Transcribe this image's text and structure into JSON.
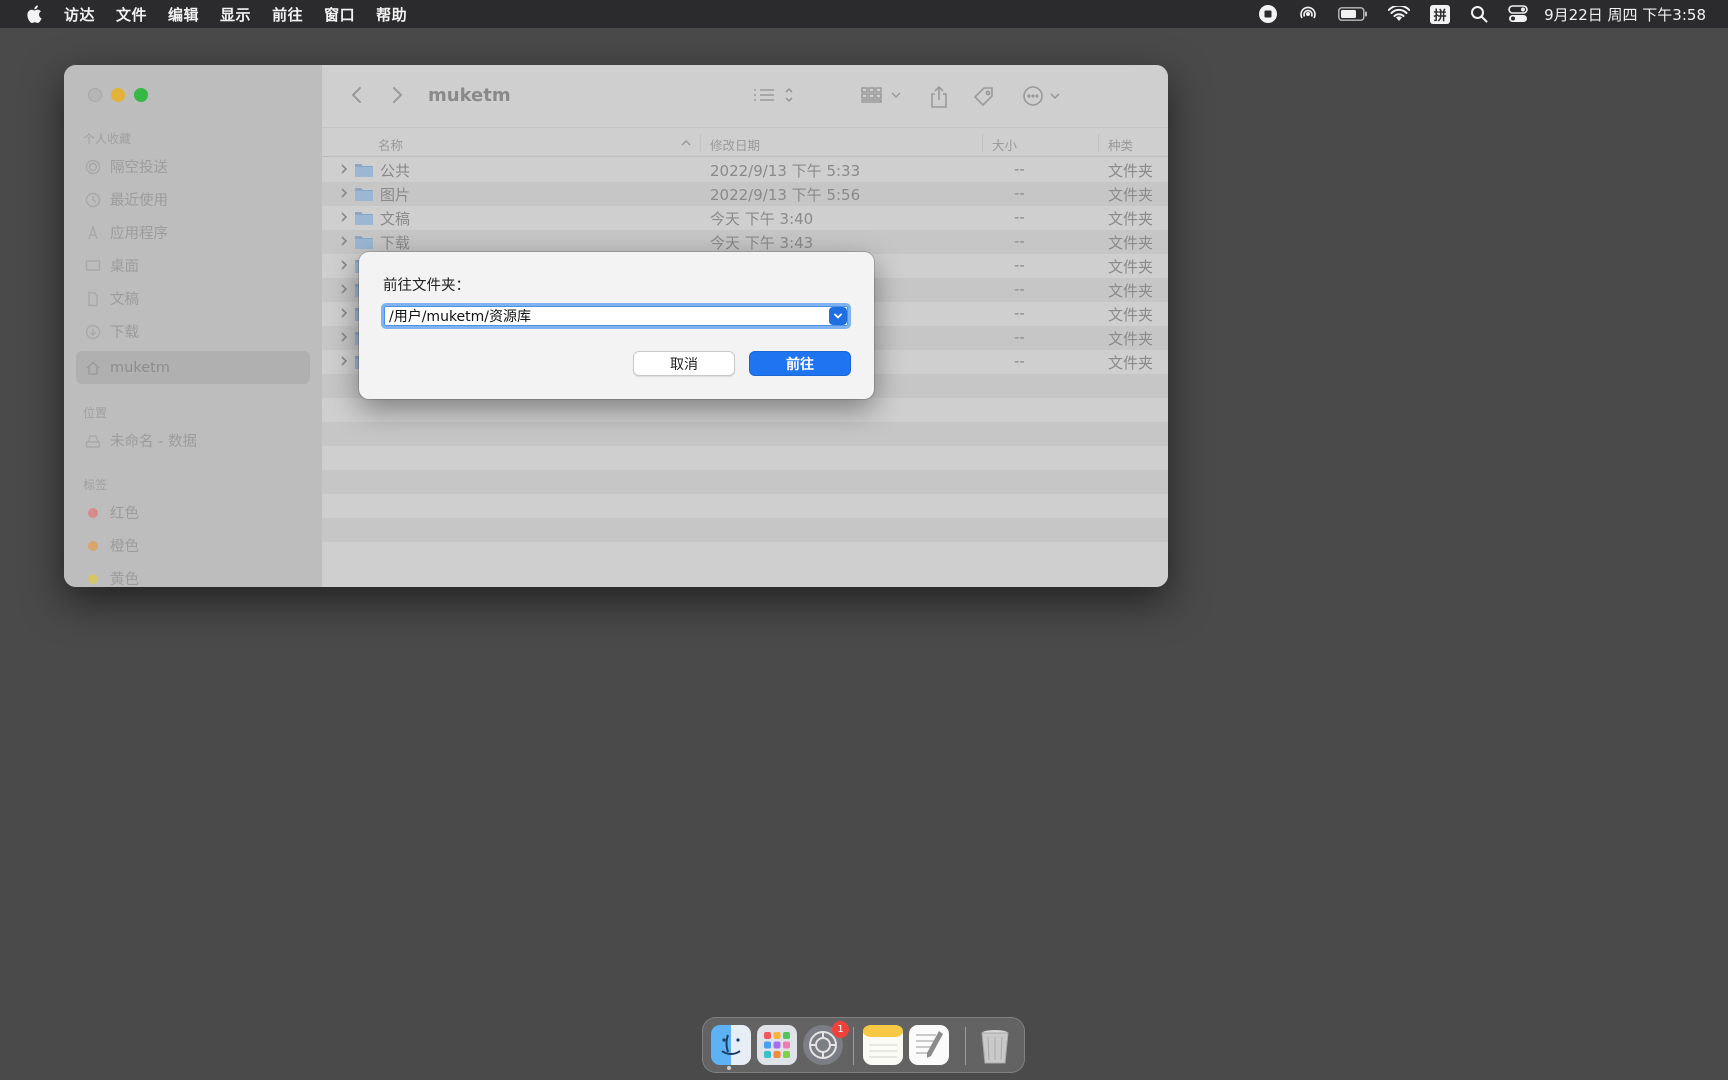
{
  "menubar": {
    "apple_icon": "apple-logo-icon",
    "items": [
      "访达",
      "文件",
      "编辑",
      "显示",
      "前往",
      "窗口",
      "帮助"
    ],
    "clock": "9月22日 周四 下午3:58",
    "input_method": "拼"
  },
  "finder": {
    "title": "muketm",
    "sidebar": {
      "favorites_header": "个人收藏",
      "favorites": [
        "隔空投送",
        "最近使用",
        "应用程序",
        "桌面",
        "文稿",
        "下载",
        "muketm"
      ],
      "locations_header": "位置",
      "locations": [
        "未命名 - 数据"
      ],
      "tags_header": "标签",
      "tags": [
        {
          "label": "红色",
          "color": "#d98a8a"
        },
        {
          "label": "橙色",
          "color": "#d8a56a"
        },
        {
          "label": "黄色",
          "color": "#d4c46a"
        }
      ]
    },
    "columns": {
      "name": "名称",
      "date": "修改日期",
      "size": "大小",
      "kind": "种类"
    },
    "rows": [
      {
        "name": "公共",
        "date": "2022/9/13 下午 5:33",
        "size": "--",
        "kind": "文件夹"
      },
      {
        "name": "图片",
        "date": "2022/9/13 下午 5:56",
        "size": "--",
        "kind": "文件夹"
      },
      {
        "name": "文稿",
        "date": "今天 下午 3:40",
        "size": "--",
        "kind": "文件夹"
      },
      {
        "name": "下载",
        "date": "今天 下午 3:43",
        "size": "--",
        "kind": "文件夹"
      },
      {
        "name": "",
        "date": "",
        "size": "--",
        "kind": "文件夹"
      },
      {
        "name": "",
        "date": "",
        "size": "--",
        "kind": "文件夹"
      },
      {
        "name": "",
        "date": "",
        "size": "--",
        "kind": "文件夹"
      },
      {
        "name": "",
        "date": "",
        "size": "--",
        "kind": "文件夹"
      },
      {
        "name": "",
        "date": "",
        "size": "--",
        "kind": "文件夹"
      }
    ]
  },
  "dialog": {
    "label": "前往文件夹：",
    "path_value": "/用户/muketm/资源库",
    "cancel_label": "取消",
    "go_label": "前往"
  },
  "dock": {
    "settings_badge": "1"
  },
  "colors": {
    "accent": "#1f75f0",
    "desktop": "#4a4a4a",
    "menubar": "#2b2b2d"
  }
}
